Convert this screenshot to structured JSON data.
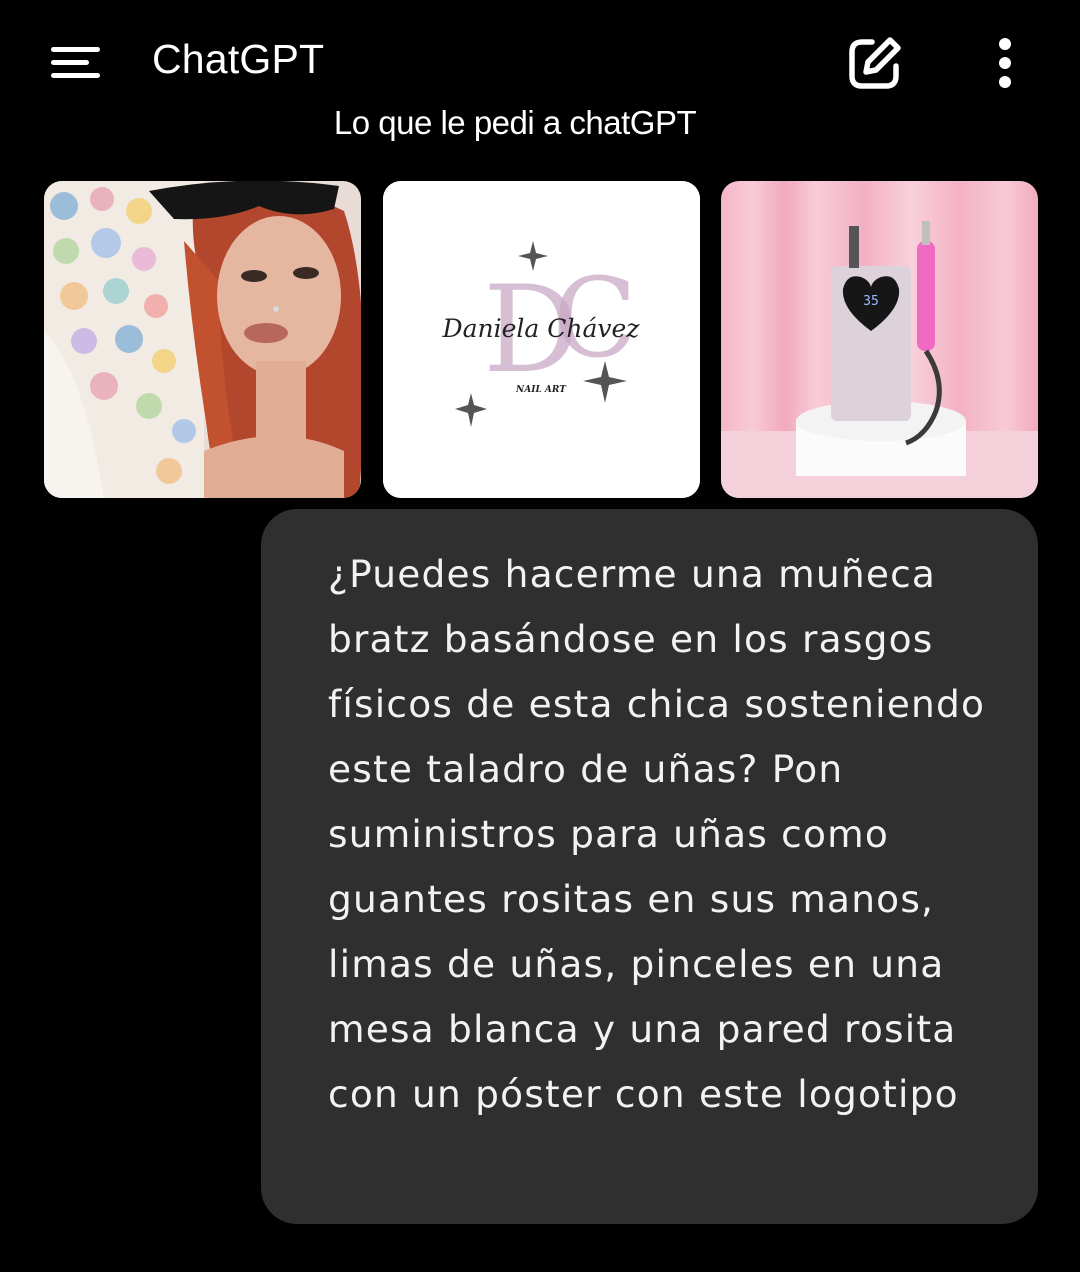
{
  "app_bar": {
    "title": "ChatGPT",
    "menu_icon": "hamburger-menu-icon",
    "new_chat_icon": "edit-pencil-icon",
    "more_icon": "vertical-ellipsis-icon"
  },
  "caption": "Lo que le pedi a chatGPT",
  "attachments": [
    {
      "kind": "photo",
      "icon": "portrait-photo"
    },
    {
      "kind": "logo",
      "logo_text": "Daniela Chávez",
      "logo_subtext": "NAIL ART",
      "monogram": "DC"
    },
    {
      "kind": "photo",
      "icon": "nail-drill-photo",
      "display_text": "35"
    }
  ],
  "message": {
    "role": "user",
    "text": "¿Puedes hacerme una muñeca bratz basándose en los rasgos físicos de esta chica sosteniendo este taladro de uñas? Pon suministros para uñas como guantes rositas en sus manos, limas de uñas, pinceles en una mesa blanca y una pared rosita con un póster con este logotipo"
  },
  "colors": {
    "background": "#000000",
    "bubble": "#2f2f2f",
    "text": "#ffffff",
    "logo_pink": "#c9a9c6"
  }
}
